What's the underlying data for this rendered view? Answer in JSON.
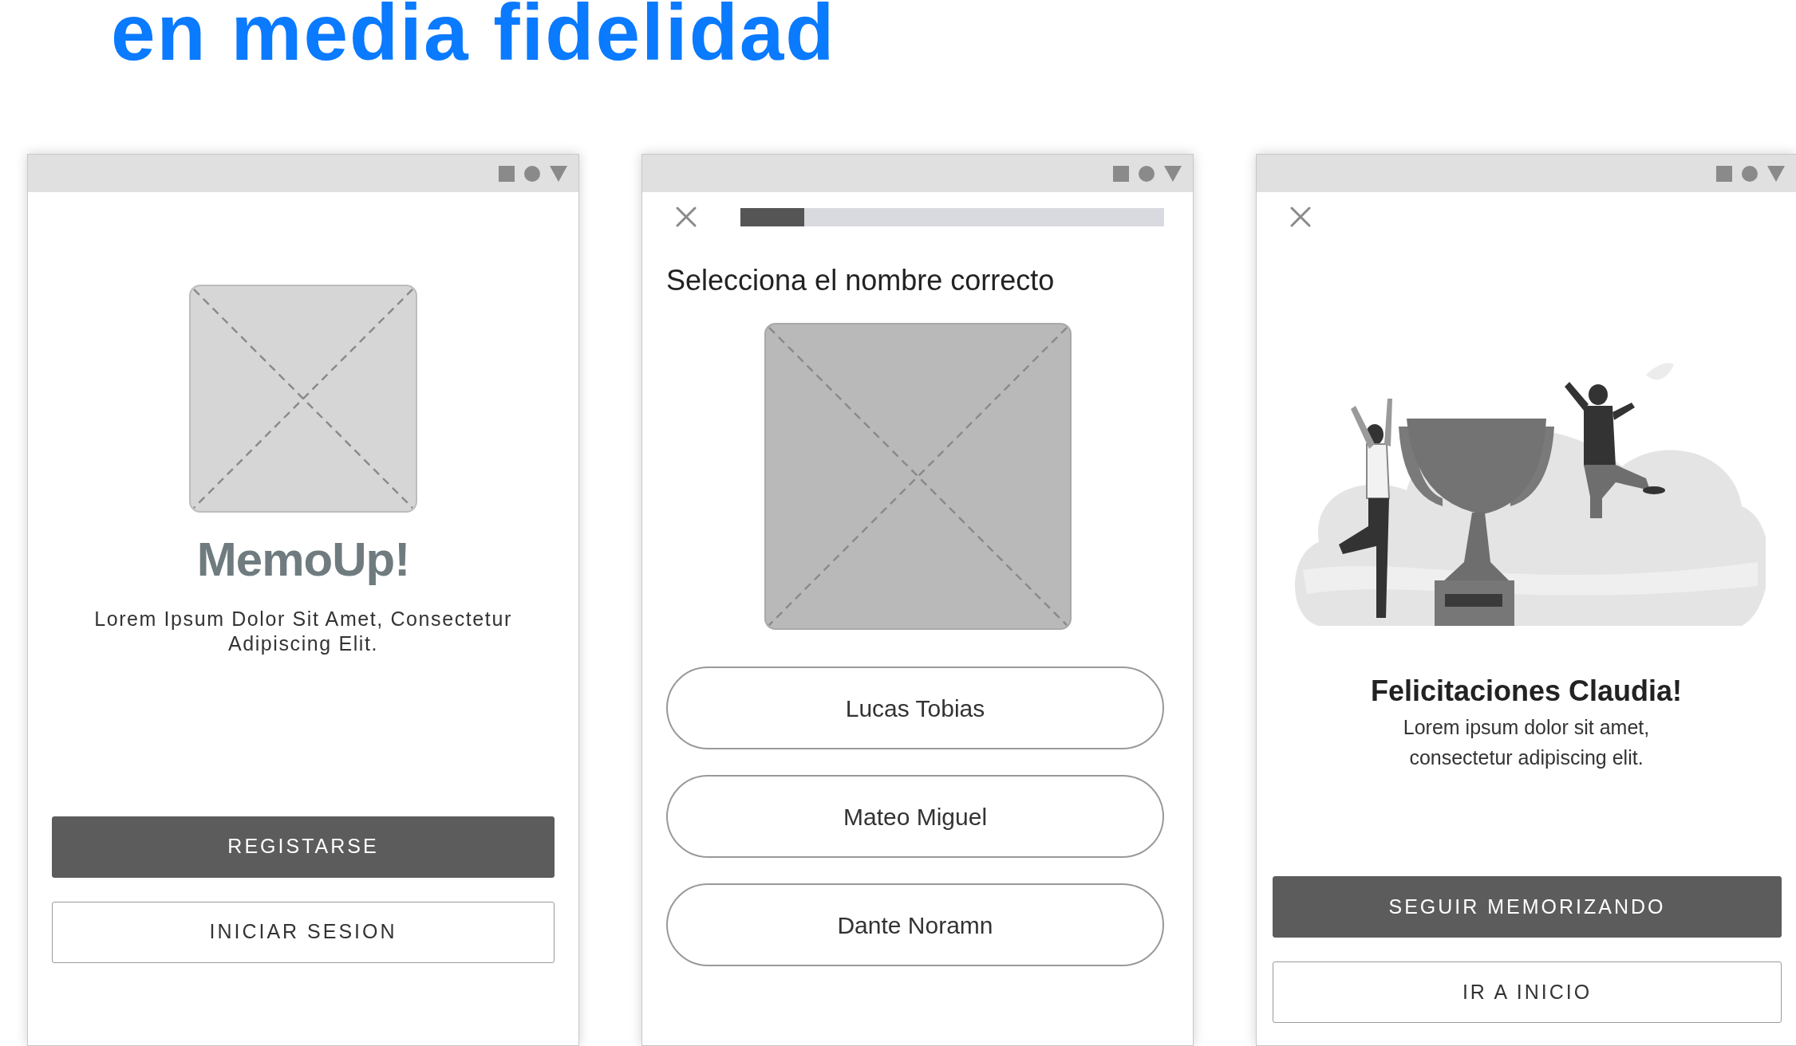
{
  "heading": "en media fidelidad",
  "screens": [
    {
      "kind": "welcome",
      "title": "MemoUp!",
      "text": "Lorem Ipsum Dolor Sit Amet, Consectetur Adipiscing Elit.",
      "buttons": [
        {
          "label": "REGISTARSE",
          "kind": "primary"
        },
        {
          "label": "INICIAR SESION",
          "kind": "outline"
        }
      ]
    },
    {
      "kind": "quiz",
      "progress": {
        "level": 0.15
      },
      "question": "Selecciona el nombre correcto",
      "options": [
        {
          "label": "Lucas Tobias"
        },
        {
          "label": "Mateo Miguel"
        },
        {
          "label": "Dante Noramn"
        }
      ]
    },
    {
      "kind": "result",
      "title": "Felicitaciones Claudia!",
      "text": "Lorem ipsum dolor sit amet, consectetur adipiscing elit.",
      "buttons": [
        {
          "label": "SEGUIR MEMORIZANDO",
          "kind": "primary"
        },
        {
          "label": "IR A INICIO",
          "kind": "outline"
        }
      ]
    }
  ]
}
